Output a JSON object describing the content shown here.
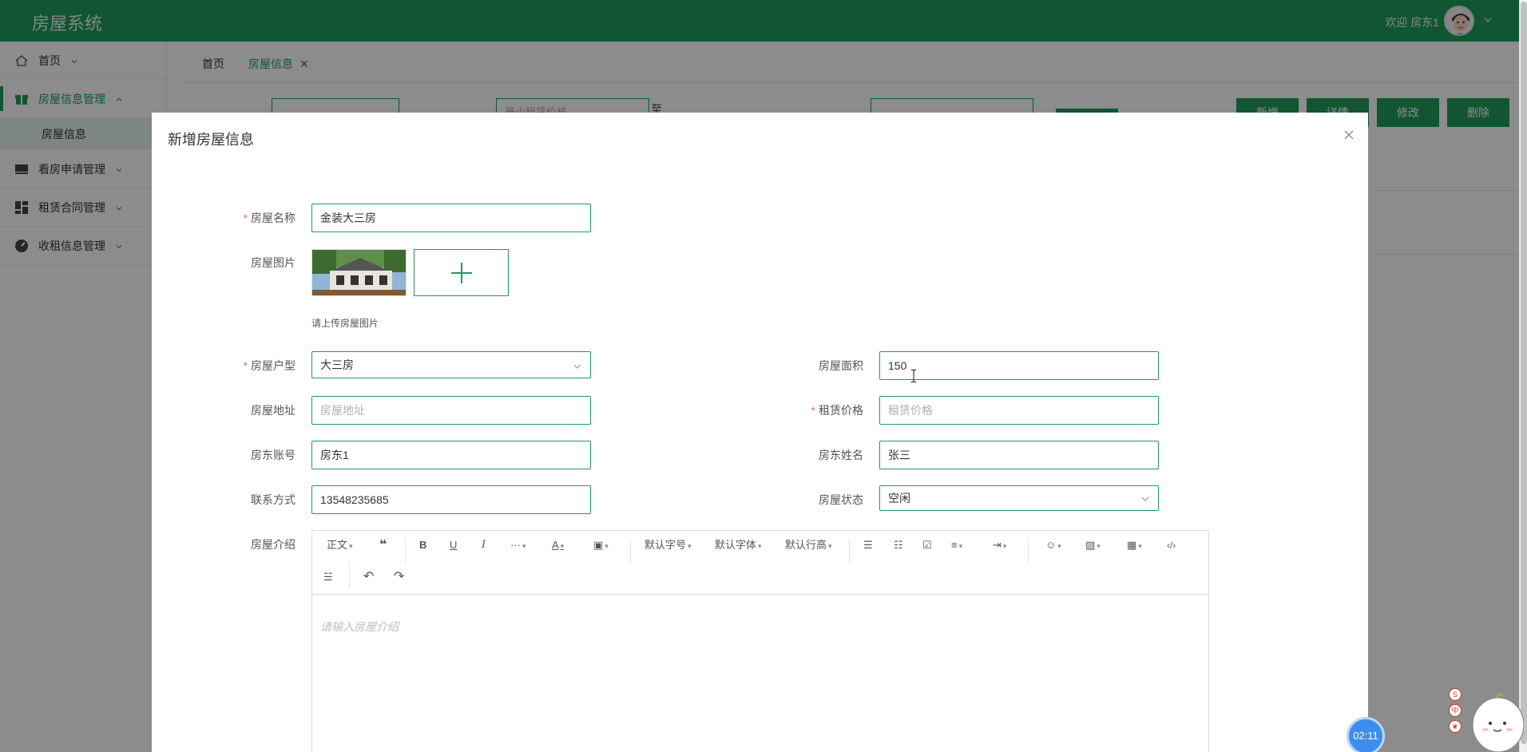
{
  "app": {
    "brand": "房屋系统",
    "welcome": "欢迎 房东1"
  },
  "sidebar": {
    "items": [
      {
        "label": "首页",
        "icon": "home-icon"
      },
      {
        "label": "房屋信息管理",
        "icon": "gift-icon",
        "active": true,
        "children": [
          {
            "label": "房屋信息"
          }
        ]
      },
      {
        "label": "看房申请管理",
        "icon": "monitor-icon"
      },
      {
        "label": "租赁合同管理",
        "icon": "grid-icon"
      },
      {
        "label": "收租信息管理",
        "icon": "gauge-icon"
      }
    ]
  },
  "tabs": [
    {
      "label": "首页"
    },
    {
      "label": "房屋信息",
      "closable": true
    }
  ],
  "background_toolbar": {
    "min_price_placeholder": "最小租赁价格",
    "range_separator": "至",
    "buttons": {
      "add": "新增",
      "detail": "详情",
      "edit": "修改",
      "delete": "删除"
    }
  },
  "modal": {
    "title": "新增房屋信息",
    "form": {
      "name": {
        "label": "房屋名称",
        "required": true,
        "value": "金装大三房"
      },
      "image": {
        "label": "房屋图片",
        "hint": "请上传房屋图片"
      },
      "type": {
        "label": "房屋户型",
        "required": true,
        "value": "大三房"
      },
      "area": {
        "label": "房屋面积",
        "value": "150"
      },
      "address": {
        "label": "房屋地址",
        "placeholder": "房屋地址"
      },
      "price": {
        "label": "租赁价格",
        "required": true,
        "placeholder": "租赁价格"
      },
      "landlord_account": {
        "label": "房东账号",
        "value": "房东1"
      },
      "landlord_name": {
        "label": "房东姓名",
        "value": "张三"
      },
      "contact": {
        "label": "联系方式",
        "value": "13548235685"
      },
      "status": {
        "label": "房屋状态",
        "value": "空闲"
      },
      "intro": {
        "label": "房屋介绍",
        "placeholder": "请输入房屋介绍"
      }
    },
    "editor_toolbar": {
      "paragraph": "正文",
      "font_size": "默认字号",
      "font_family": "默认字体",
      "line_height": "默认行高"
    }
  },
  "widgets": {
    "timer": "02:11",
    "mini_icons": [
      "S",
      "中",
      "❦"
    ]
  },
  "colors": {
    "primary": "#1f9b5c",
    "required": "#f56c6c",
    "timer": "#3b8ef0"
  }
}
